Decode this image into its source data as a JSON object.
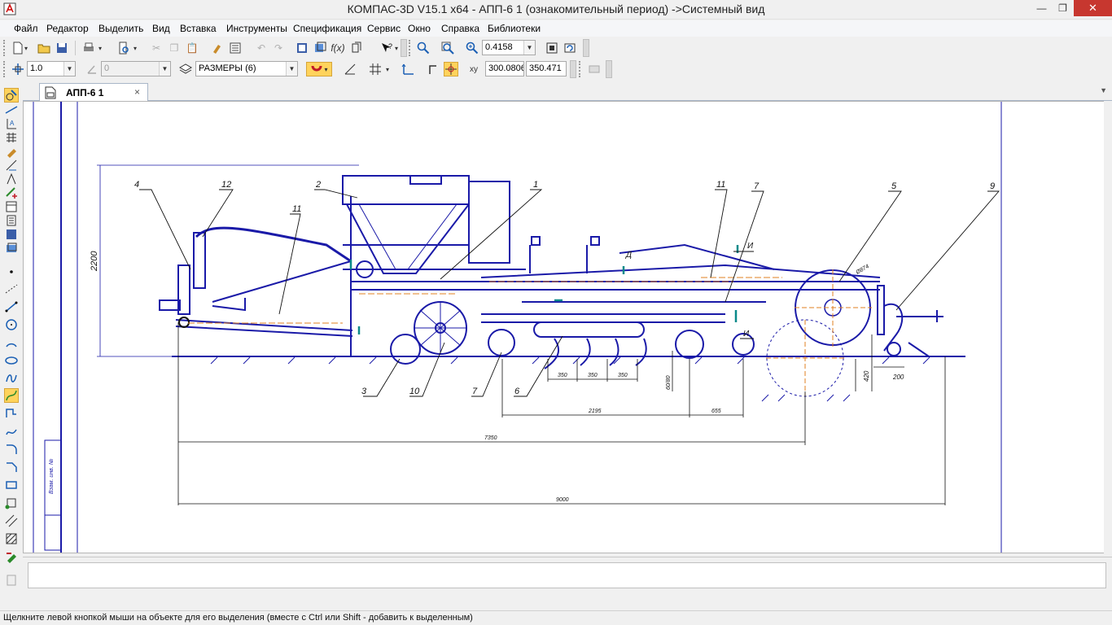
{
  "window": {
    "title": "КОМПАС-3D V15.1 x64 - АПП-6 1 (ознакомительный период) ->Системный вид",
    "minimize_glyph": "—",
    "restore_glyph": "❐",
    "close_glyph": "✕"
  },
  "menu": [
    {
      "label": "Файл"
    },
    {
      "label": "Редактор"
    },
    {
      "label": "Выделить"
    },
    {
      "label": "Вид"
    },
    {
      "label": "Вставка"
    },
    {
      "label": "Инструменты"
    },
    {
      "label": "Спецификация"
    },
    {
      "label": "Сервис"
    },
    {
      "label": "Окно"
    },
    {
      "label": "Справка"
    },
    {
      "label": "Библиотеки"
    }
  ],
  "toolbar1": {
    "zoom_value": "0.4158"
  },
  "toolbar2": {
    "step_value": "1.0",
    "angle_value": "0",
    "layer_value": "РАЗМЕРЫ (6)",
    "coord_x": "300.0806",
    "coord_y": "350.471"
  },
  "document_tab": {
    "label": "АПП-6 1",
    "close_glyph": "×"
  },
  "drawing": {
    "callouts": [
      "4",
      "12",
      "11",
      "2",
      "1",
      "11",
      "7",
      "5",
      "9",
      "3",
      "10",
      "7",
      "6",
      "И",
      "И",
      "Д"
    ],
    "dimensions": {
      "height_2200": "2200",
      "spacing_350_a": "350",
      "spacing_350_b": "350",
      "spacing_350_c": "350",
      "depth_60_80": "60/80",
      "dim_420": "420",
      "dim_200": "200",
      "dim_2195": "2195",
      "dim_655": "655",
      "dim_7350": "7350",
      "dim_9000": "9000",
      "radius_label": "Ø874"
    },
    "title_block_text": "Взам. инв. №"
  },
  "status_bar": {
    "text": "Щелкните левой кнопкой мыши на объекте для его выделения (вместе с Ctrl или Shift - добавить к выделенным)"
  },
  "colors": {
    "drawing_blue": "#1a1aa8",
    "drawing_black": "#111111",
    "axis_orange": "#e08020",
    "teal_marker": "#0a8a8a",
    "close_red": "#c7372f",
    "active_yellow": "#ffd35c"
  }
}
